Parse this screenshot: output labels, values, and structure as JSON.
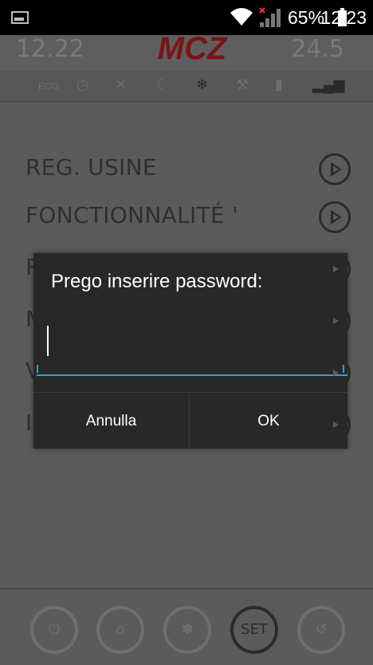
{
  "status_bar": {
    "battery_percent": "65%",
    "time": "12:23"
  },
  "header": {
    "left_value": "12.22",
    "right_value": "24.5",
    "logo_text": "MCZ"
  },
  "icon_bar": {
    "eco_label": "ECO"
  },
  "menu": {
    "items": [
      {
        "label": "REG. USINE"
      },
      {
        "label": "FONCTIONNALITÉ '"
      },
      {
        "label": "R"
      },
      {
        "label": "M"
      },
      {
        "label": "V"
      },
      {
        "label": "I"
      }
    ]
  },
  "bottom_bar": {
    "set_label": "SET"
  },
  "dialog": {
    "title": "Prego inserire password:",
    "password_value": "",
    "cancel_label": "Annulla",
    "ok_label": "OK"
  },
  "colors": {
    "accent": "#33a0d0",
    "dialog_bg": "#282828",
    "dim_bg": "#5b5b5b"
  }
}
